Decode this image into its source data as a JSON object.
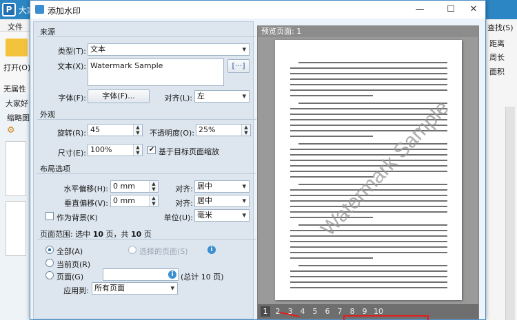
{
  "background_app": {
    "title": "大家",
    "menu_file": "文件",
    "open_label": "打开(O)...",
    "no_props": "无属性",
    "doc_tab": "大家好",
    "thumbnails": "缩略图",
    "right_items": [
      "查找(S)",
      "距离",
      "周长",
      "面积"
    ]
  },
  "dialog": {
    "title": "添加水印",
    "minimize": "—",
    "maximize": "☐",
    "close": "✕"
  },
  "source": {
    "section": "来源",
    "type_label": "类型(T):",
    "type_value": "文本",
    "text_label": "文本(X):",
    "text_value": "Watermark Sample",
    "insert_btn": "[···]",
    "font_label": "字体(F):",
    "font_btn": "字体(F)...",
    "align_label": "对齐(L):",
    "align_value": "左"
  },
  "appearance": {
    "section": "外观",
    "rotation_label": "旋转(R):",
    "rotation_value": "45",
    "opacity_label": "不透明度(O):",
    "opacity_value": "25%",
    "size_label": "尺寸(E):",
    "size_value": "100%",
    "scale_checkbox": "基于目标页面缩放",
    "scale_checked": true
  },
  "layout": {
    "section": "布局选项",
    "h_offset_label": "水平偏移(H):",
    "h_offset_value": "0 mm",
    "h_align_label": "对齐:",
    "h_align_value": "居中",
    "v_offset_label": "垂直偏移(V):",
    "v_offset_value": "0 mm",
    "v_align_label": "对齐:",
    "v_align_value": "居中",
    "as_background": "作为背景(K)",
    "as_background_checked": false,
    "unit_label": "单位(U):",
    "unit_value": "毫米"
  },
  "page_range": {
    "section_prefix": "页面范围: 选中",
    "selected_count": "10",
    "section_mid": "页，共",
    "total_count": "10",
    "section_suffix": "页",
    "all_label": "全部(A)",
    "selected_pages_label": "选择的页面(S)",
    "current_label": "当前页(R)",
    "pages_label": "页面(G)",
    "pages_value": "",
    "pages_total": "(总计 10 页)",
    "apply_label": "应用到:",
    "apply_value": "所有页面"
  },
  "preview": {
    "header": "预览页面: 1",
    "watermark": "Watermark Sample",
    "pages": [
      "1",
      "2",
      "3",
      "4",
      "5",
      "6",
      "7",
      "8",
      "9",
      "10"
    ],
    "current_page": "1"
  }
}
